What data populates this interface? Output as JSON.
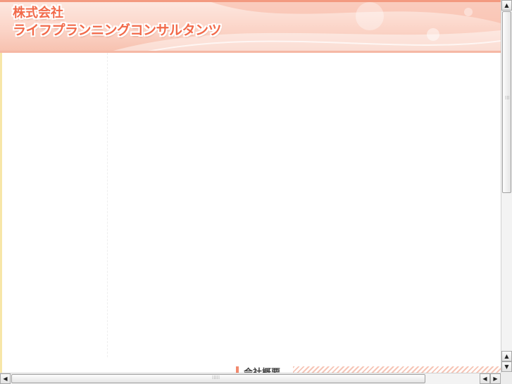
{
  "header": {
    "company_prefix": "株式会社",
    "company_name": "ライフプランニングコンサルタンツ",
    "accent_color": "#f26a4a"
  },
  "content": {
    "section_heading": "会社概要"
  },
  "scrollbars": {
    "up_arrow": "▲",
    "down_arrow": "▼",
    "left_arrow": "◀",
    "right_arrow": "▶"
  }
}
